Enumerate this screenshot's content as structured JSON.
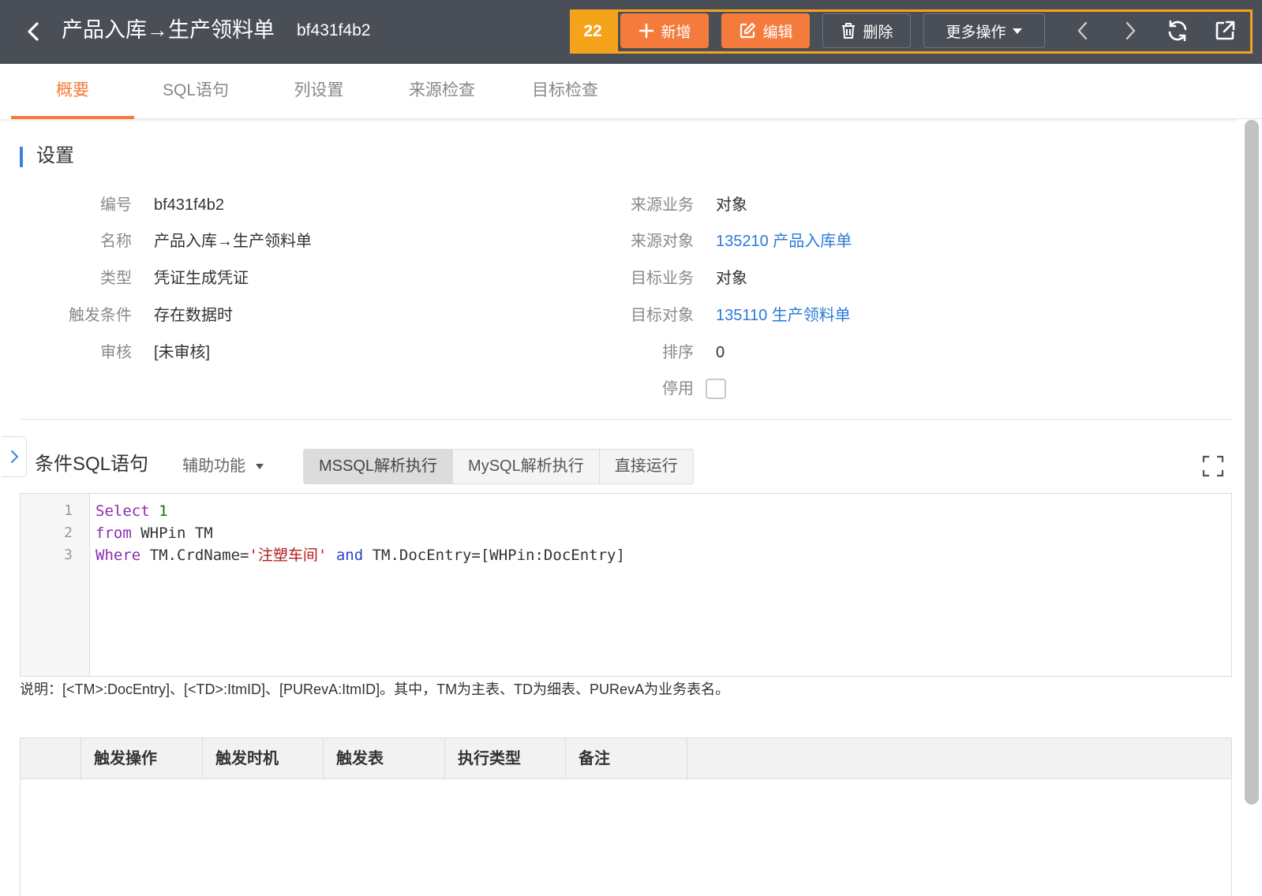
{
  "header": {
    "title": "产品入库→生产领料单",
    "code": "bf431f4b2",
    "badge": "22",
    "buttons": {
      "add": "新增",
      "edit": "编辑",
      "delete": "删除",
      "more": "更多操作"
    }
  },
  "tabs": [
    "概要",
    "SQL语句",
    "列设置",
    "来源检查",
    "目标检查"
  ],
  "settings": {
    "section_title": "设置",
    "left": [
      {
        "label": "编号",
        "value": "bf431f4b2"
      },
      {
        "label": "名称",
        "value": "产品入库→生产领料单"
      },
      {
        "label": "类型",
        "value": "凭证生成凭证"
      },
      {
        "label": "触发条件",
        "value": "存在数据时"
      },
      {
        "label": "审核",
        "value": "[未审核]"
      }
    ],
    "right": [
      {
        "label": "来源业务",
        "value": "对象"
      },
      {
        "label": "来源对象",
        "value": "135210 产品入库单"
      },
      {
        "label": "目标业务",
        "value": "对象"
      },
      {
        "label": "目标对象",
        "value": "135110 生产领料单"
      },
      {
        "label": "排序",
        "value": "0"
      },
      {
        "label": "停用",
        "value": ""
      }
    ],
    "disabled_checked": false
  },
  "sql": {
    "title": "条件SQL语句",
    "aux_label": "辅助功能",
    "modes": [
      "MSSQL解析执行",
      "MySQL解析执行",
      "直接运行"
    ],
    "active_mode": "MSSQL解析执行",
    "line_numbers": [
      "1",
      "2",
      "3"
    ],
    "lines": [
      [
        {
          "t": "Select",
          "c": "kw"
        },
        {
          "t": " "
        },
        {
          "t": "1",
          "c": "num"
        }
      ],
      [
        {
          "t": "from",
          "c": "kw"
        },
        {
          "t": " WHPin TM"
        }
      ],
      [
        {
          "t": "Where",
          "c": "kw"
        },
        {
          "t": " TM.CrdName="
        },
        {
          "t": "'注塑车间'",
          "c": "str"
        },
        {
          "t": " "
        },
        {
          "t": "and",
          "c": "kwb"
        },
        {
          "t": " TM.DocEntry=[WHPin:DocEntry]"
        }
      ]
    ],
    "note": "说明：[<TM>:DocEntry]、[<TD>:ItmID]、[PURevA:ItmID]。其中，TM为主表、TD为细表、PURevA为业务表名。"
  },
  "table": {
    "columns": [
      "",
      "触发操作",
      "触发时机",
      "触发表",
      "执行类型",
      "备注"
    ],
    "rows": []
  },
  "colors": {
    "header_bg": "#4a4f57",
    "accent": "#f47b3c",
    "highlight": "#f5a31a",
    "link": "#2b7ad8",
    "section_bar": "#3d82e0"
  }
}
